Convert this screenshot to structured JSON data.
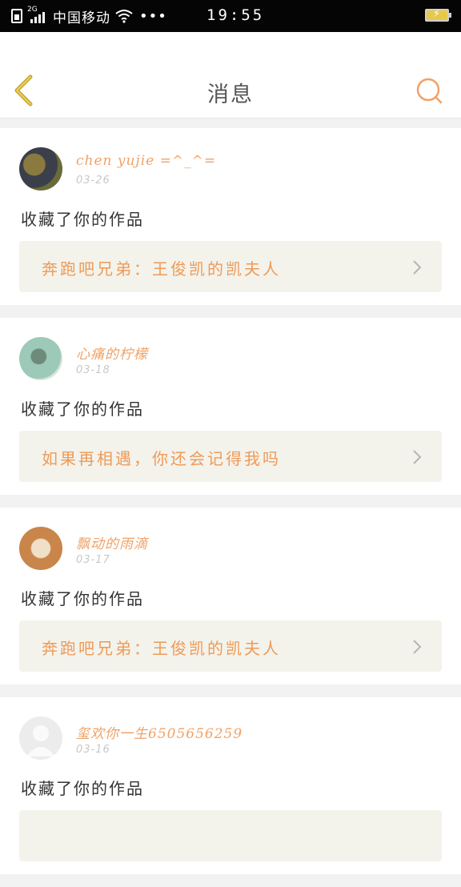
{
  "status_bar": {
    "network_type": "2G",
    "carrier": "中国移动",
    "more": "•••",
    "time": "19:55",
    "icons": [
      "sim-icon",
      "signal-icon",
      "wifi-icon",
      "battery-charging-icon"
    ]
  },
  "header": {
    "title": "消息",
    "back_icon": "chevron-left-icon",
    "search_icon": "search-icon"
  },
  "colors": {
    "accent": "#f0a268",
    "link_bg": "#f3f3ec",
    "back_icon": "#c9a52a"
  },
  "messages": [
    {
      "user": "chen yujie =^_^=",
      "date": "03-26",
      "action": "收藏了你的作品",
      "work": "奔跑吧兄弟：王俊凯的凯夫人",
      "avatar_colors": [
        "#3a3f4a",
        "#8a7a40"
      ]
    },
    {
      "user": "心痛的柠檬",
      "date": "03-18",
      "action": "收藏了你的作品",
      "work": "如果再相遇，你还会记得我吗",
      "avatar_colors": [
        "#9cc9b8",
        "#d9e6d8"
      ]
    },
    {
      "user": "飘动的雨滴",
      "date": "03-17",
      "action": "收藏了你的作品",
      "work": "奔跑吧兄弟：王俊凯的凯夫人",
      "avatar_colors": [
        "#c9854a",
        "#f0e0c8"
      ]
    },
    {
      "user": "玺欢你一生6505656259",
      "date": "03-16",
      "action": "收藏了你的作品",
      "work": "",
      "avatar_colors": [
        "#e6e6e6",
        "#f5f5f5"
      ]
    }
  ]
}
